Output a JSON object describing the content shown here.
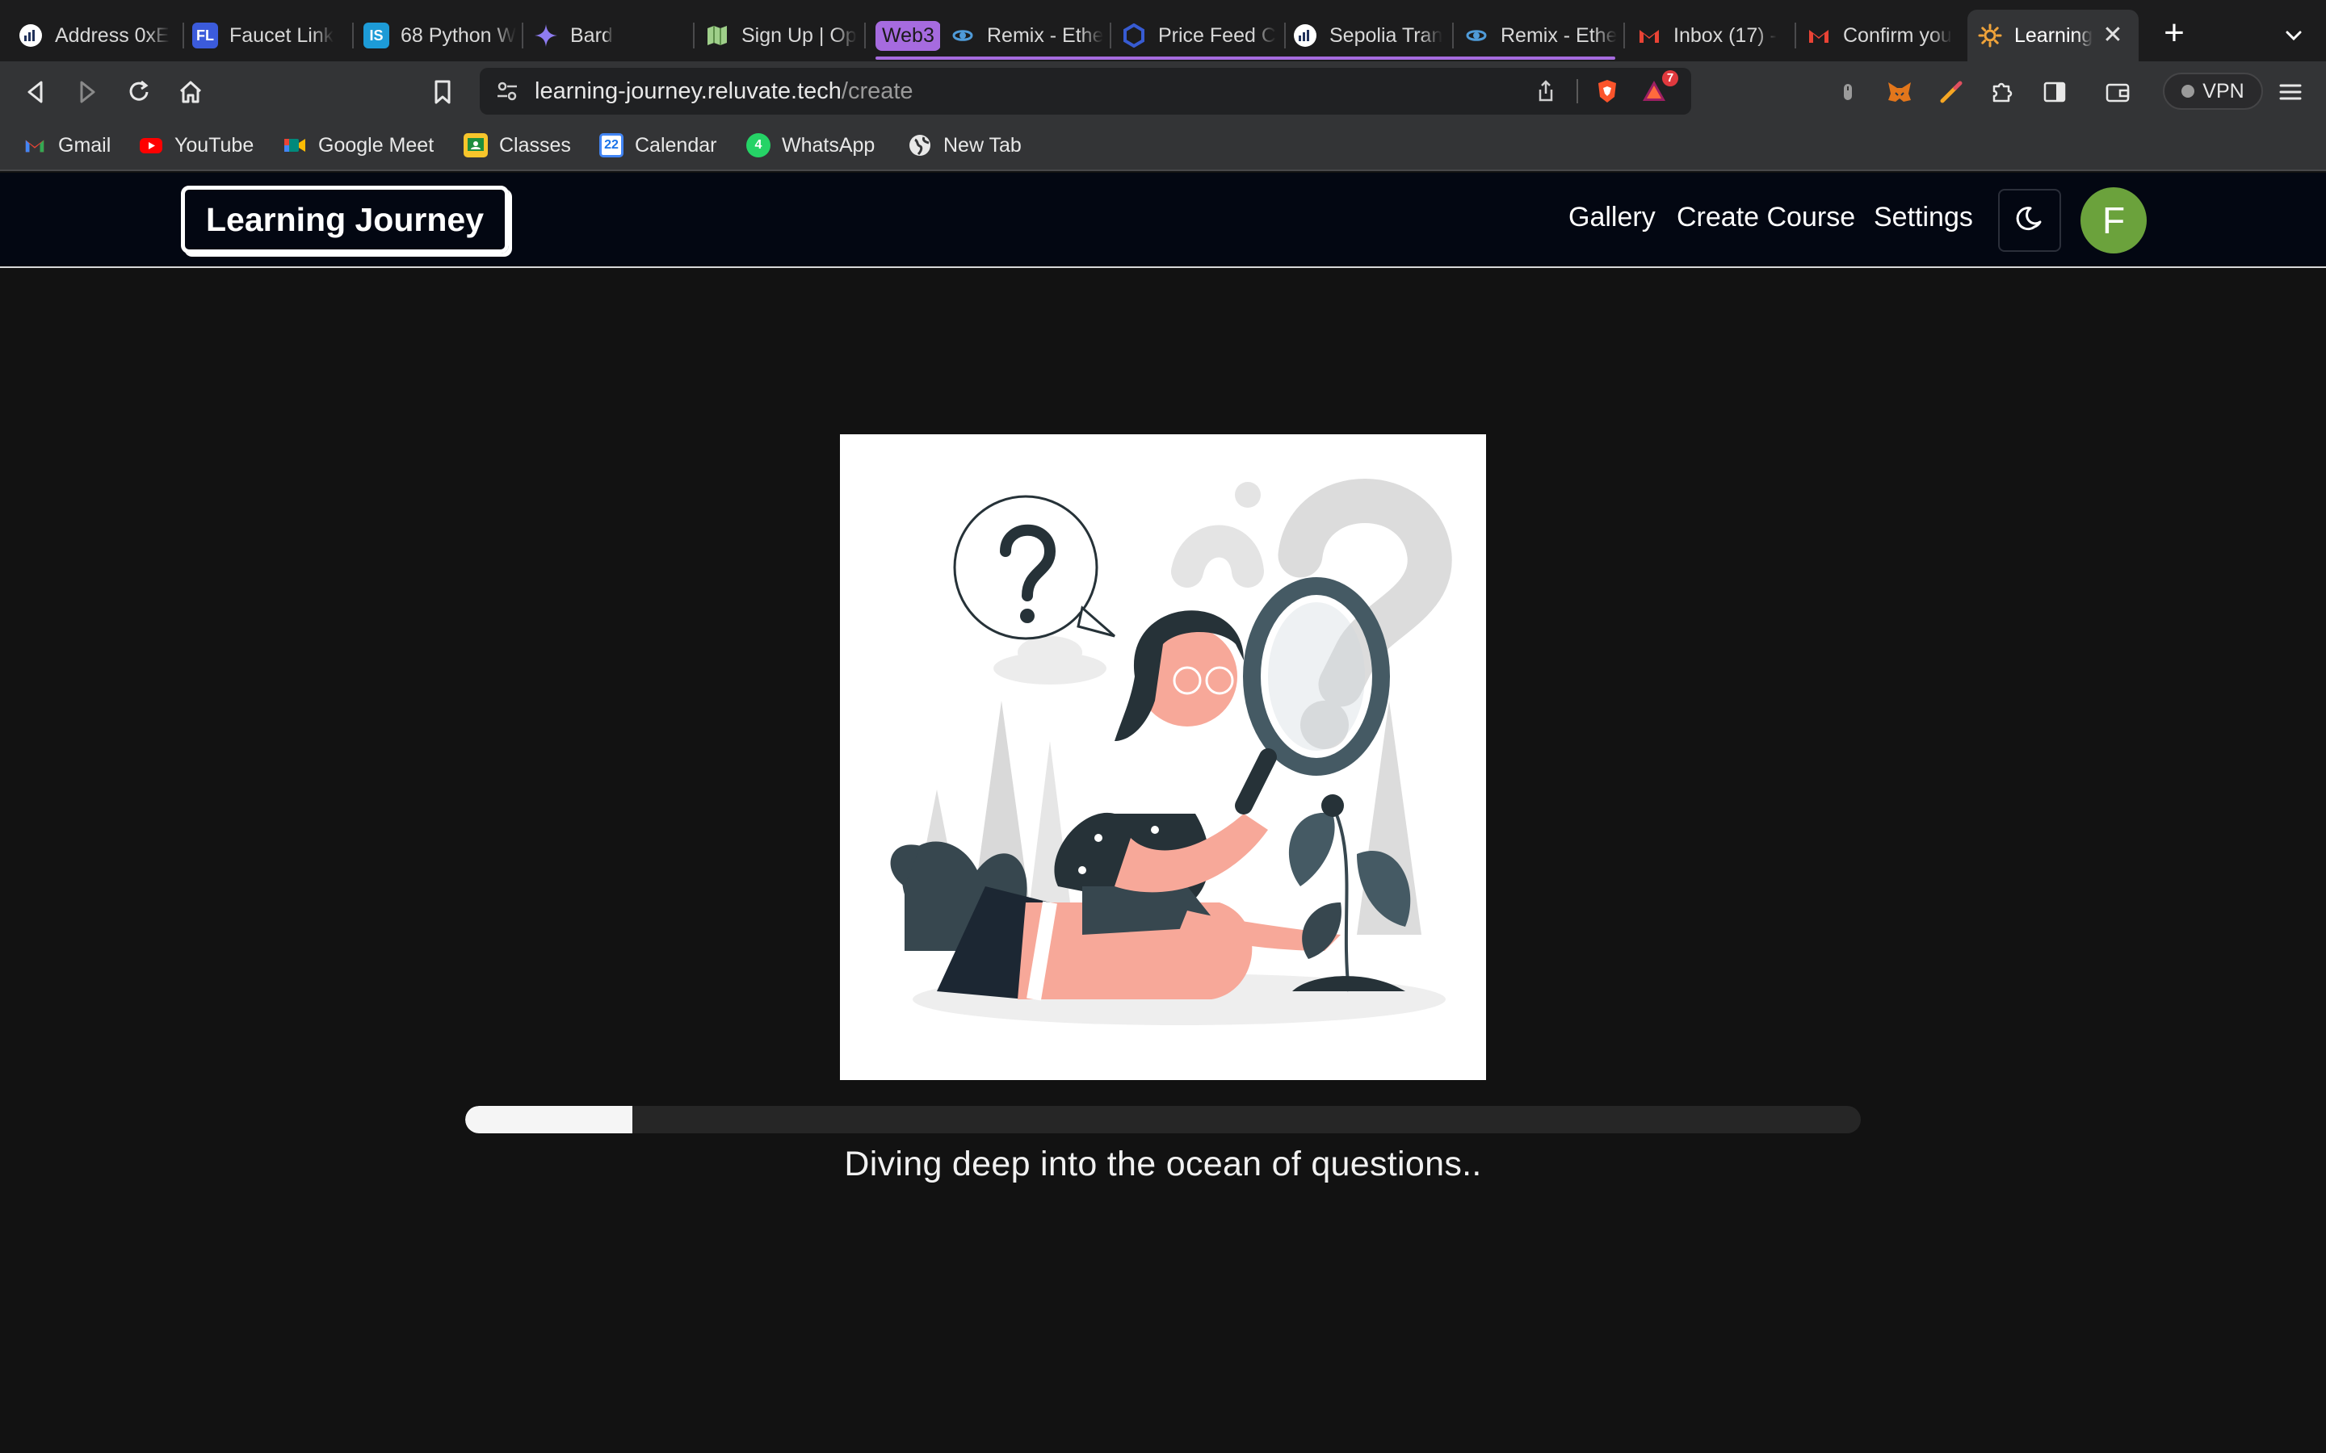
{
  "browser": {
    "tabs": [
      {
        "label": "Address 0xE",
        "icon": "etherscan-icon"
      },
      {
        "label": "Faucet Link",
        "icon": "fl-icon"
      },
      {
        "label": "68 Python W",
        "icon": "is-icon"
      },
      {
        "label": "Bard",
        "icon": "bard-sparkle-icon"
      },
      {
        "label": "Sign Up | Op",
        "icon": "map-icon"
      },
      {
        "label": "Remix - Ethe",
        "icon": "remix-icon"
      },
      {
        "label": "Price Feed C",
        "icon": "chainlink-icon"
      },
      {
        "label": "Sepolia Tran",
        "icon": "etherscan-icon"
      },
      {
        "label": "Remix - Ethe",
        "icon": "remix-icon"
      },
      {
        "label": "Inbox (17) -",
        "icon": "gmail-icon"
      },
      {
        "label": "Confirm you",
        "icon": "gmail-icon"
      },
      {
        "label": "Learning",
        "icon": "sun-icon",
        "active": true
      }
    ],
    "tab_group_label": "Web3",
    "fl_badge": "FL",
    "is_badge": "IS",
    "url_host": "learning-journey.reluvate.tech",
    "url_path": "/create",
    "brave_badge_count": "7",
    "vpn_label": "VPN",
    "bookmarks": [
      {
        "label": "Gmail",
        "icon": "gmail-icon"
      },
      {
        "label": "YouTube",
        "icon": "youtube-icon"
      },
      {
        "label": "Google Meet",
        "icon": "google-meet-icon"
      },
      {
        "label": "Classes",
        "icon": "google-classroom-icon"
      },
      {
        "label": "Calendar",
        "icon": "calendar-icon"
      },
      {
        "label": "WhatsApp",
        "icon": "whatsapp-icon"
      },
      {
        "label": "New Tab",
        "icon": "globe-icon"
      }
    ],
    "calendar_day": "22",
    "whatsapp_badge": "4",
    "colors": {
      "tab_group": "#a66bdf",
      "tabbar_bg": "#1c1c1d",
      "toolbar_bg": "#333436"
    }
  },
  "site": {
    "logo": "Learning Journey",
    "nav": {
      "gallery": "Gallery",
      "create_course": "Create Course",
      "settings": "Settings"
    },
    "theme_toggle_icon": "moon-icon",
    "avatar_initial": "F",
    "colors": {
      "header_bg": "#030712",
      "avatar_bg": "#6ba23c",
      "page_bg": "#121212"
    }
  },
  "main": {
    "illustration": "girl-with-magnifying-glass-question-illustration",
    "progress_percent": 12,
    "status_text": "Diving deep into the ocean of questions.."
  }
}
